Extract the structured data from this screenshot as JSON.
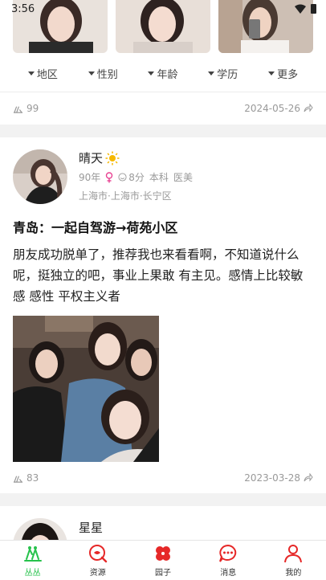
{
  "status": {
    "time": "3:56"
  },
  "filters": [
    "地区",
    "性别",
    "年龄",
    "学历",
    "更多"
  ],
  "prev_post": {
    "likes": "99",
    "date": "2024-05-26"
  },
  "post": {
    "name": "晴天",
    "age": "90年",
    "score": "8分",
    "education": "本科",
    "job": "医美",
    "location": "上海市·上海市·长宁区",
    "title": "青岛：一起自驾游→荷苑小区",
    "body": "朋友成功脱单了，推荐我也来看看啊，不知道说什么呢，挺独立的吧，事业上果敢 有主见。感情上比较敏感 感性 平权主义者",
    "likes": "83",
    "date": "2023-03-28"
  },
  "next_post": {
    "name": "星星"
  },
  "tabs": [
    {
      "label": "丛丛",
      "icon": "home-icon",
      "active": true
    },
    {
      "label": "资源",
      "icon": "resource-icon",
      "active": false
    },
    {
      "label": "园子",
      "icon": "clover-icon",
      "active": false
    },
    {
      "label": "消息",
      "icon": "message-icon",
      "active": false
    },
    {
      "label": "我的",
      "icon": "profile-icon",
      "active": false
    }
  ],
  "colors": {
    "accent_green": "#27c24c",
    "accent_red": "#e62828",
    "muted": "#999999",
    "female_pink": "#e84393"
  }
}
